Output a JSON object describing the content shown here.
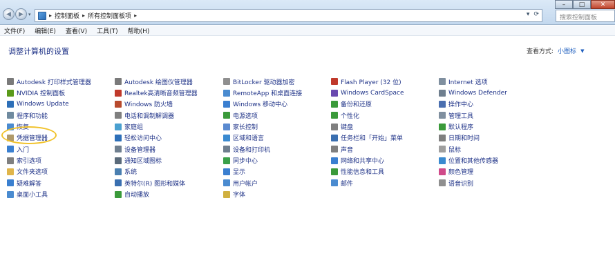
{
  "window": {
    "breadcrumb": [
      "控制面板",
      "所有控制面板项"
    ],
    "search_placeholder": "搜索控制面板",
    "controls": {
      "minimize": "–",
      "maximize": "□",
      "close": "✕"
    }
  },
  "menu": [
    "文件(F)",
    "编辑(E)",
    "查看(V)",
    "工具(T)",
    "帮助(H)"
  ],
  "page": {
    "title": "调整计算机的设置",
    "view_by_label": "查看方式:",
    "view_by_value": "小图标"
  },
  "columns": [
    [
      {
        "label": "Autodesk 打印样式管理器",
        "icon": "printer-style-icon",
        "color": "#7a7a7a"
      },
      {
        "label": "NVIDIA 控制面板",
        "icon": "nvidia-icon",
        "color": "#5a9a1a"
      },
      {
        "label": "Windows Update",
        "icon": "windows-update-icon",
        "color": "#2d6fb8"
      },
      {
        "label": "程序和功能",
        "icon": "programs-icon",
        "color": "#6f8a9f"
      },
      {
        "label": "恢复",
        "icon": "recovery-icon",
        "color": "#4a8bd0"
      },
      {
        "label": "凭据管理器",
        "icon": "credential-manager-icon",
        "color": "#b09a6a"
      },
      {
        "label": "入门",
        "icon": "getting-started-icon",
        "color": "#3a7fd0"
      },
      {
        "label": "索引选项",
        "icon": "indexing-icon",
        "color": "#7f7f7f"
      },
      {
        "label": "文件夹选项",
        "icon": "folder-options-icon",
        "color": "#e0b54a"
      },
      {
        "label": "疑难解答",
        "icon": "troubleshooting-icon",
        "color": "#3a7fd0"
      },
      {
        "label": "桌面小工具",
        "icon": "gadgets-icon",
        "color": "#4a8bd0"
      }
    ],
    [
      {
        "label": "Autodesk 绘图仪管理器",
        "icon": "plotter-icon",
        "color": "#7a7a7a"
      },
      {
        "label": "Realtek高清晰音频管理器",
        "icon": "realtek-audio-icon",
        "color": "#c0392b"
      },
      {
        "label": "Windows 防火墙",
        "icon": "firewall-icon",
        "color": "#b84a2d"
      },
      {
        "label": "电话和调制解调器",
        "icon": "phone-modem-icon",
        "color": "#7f7f7f"
      },
      {
        "label": "家庭组",
        "icon": "homegroup-icon",
        "color": "#4aa0d0"
      },
      {
        "label": "轻松访问中心",
        "icon": "ease-of-access-icon",
        "color": "#2d6fb8"
      },
      {
        "label": "设备管理器",
        "icon": "device-manager-icon",
        "color": "#6f7f8f"
      },
      {
        "label": "通知区域图标",
        "icon": "notification-area-icon",
        "color": "#5a6a7a"
      },
      {
        "label": "系统",
        "icon": "system-icon",
        "color": "#4a7fb0"
      },
      {
        "label": "英特尔(R) 图形和媒体",
        "icon": "intel-graphics-icon",
        "color": "#3a6fb0"
      },
      {
        "label": "自动播放",
        "icon": "autoplay-icon",
        "color": "#3a9a3a"
      }
    ],
    [
      {
        "label": "BitLocker 驱动器加密",
        "icon": "bitlocker-icon",
        "color": "#8f8f8f"
      },
      {
        "label": "RemoteApp 和桌面连接",
        "icon": "remoteapp-icon",
        "color": "#4a8bd0"
      },
      {
        "label": "Windows 移动中心",
        "icon": "mobility-center-icon",
        "color": "#3a7fd0"
      },
      {
        "label": "电源选项",
        "icon": "power-options-icon",
        "color": "#3a9a3a"
      },
      {
        "label": "家长控制",
        "icon": "parental-controls-icon",
        "color": "#5a8ad0"
      },
      {
        "label": "区域和语言",
        "icon": "region-language-icon",
        "color": "#3a8ad0"
      },
      {
        "label": "设备和打印机",
        "icon": "devices-printers-icon",
        "color": "#6f7f8f"
      },
      {
        "label": "同步中心",
        "icon": "sync-center-icon",
        "color": "#3aa04a"
      },
      {
        "label": "显示",
        "icon": "display-icon",
        "color": "#3a7fd0"
      },
      {
        "label": "用户帐户",
        "icon": "user-accounts-icon",
        "color": "#4a8bd0"
      },
      {
        "label": "字体",
        "icon": "fonts-icon",
        "color": "#d0b040"
      }
    ],
    [
      {
        "label": "Flash Player (32 位)",
        "icon": "flash-player-icon",
        "color": "#c0392b"
      },
      {
        "label": "Windows CardSpace",
        "icon": "cardspace-icon",
        "color": "#6a4ab0"
      },
      {
        "label": "备份和还原",
        "icon": "backup-restore-icon",
        "color": "#3a9a3a"
      },
      {
        "label": "个性化",
        "icon": "personalization-icon",
        "color": "#3a9a3a"
      },
      {
        "label": "键盘",
        "icon": "keyboard-icon",
        "color": "#7f7f7f"
      },
      {
        "label": "任务栏和「开始」菜单",
        "icon": "taskbar-start-icon",
        "color": "#3a6fb0"
      },
      {
        "label": "声音",
        "icon": "sound-icon",
        "color": "#7f7f7f"
      },
      {
        "label": "网络和共享中心",
        "icon": "network-sharing-icon",
        "color": "#3a7fd0"
      },
      {
        "label": "性能信息和工具",
        "icon": "performance-icon",
        "color": "#3a9a3a"
      },
      {
        "label": "邮件",
        "icon": "mail-icon",
        "color": "#4a8bd0"
      }
    ],
    [
      {
        "label": "Internet 选项",
        "icon": "internet-options-icon",
        "color": "#7f8f9f"
      },
      {
        "label": "Windows Defender",
        "icon": "windows-defender-icon",
        "color": "#6f7f8f"
      },
      {
        "label": "操作中心",
        "icon": "action-center-icon",
        "color": "#4a6fb0"
      },
      {
        "label": "管理工具",
        "icon": "admin-tools-icon",
        "color": "#7f8f9f"
      },
      {
        "label": "默认程序",
        "icon": "default-programs-icon",
        "color": "#3a9a3a"
      },
      {
        "label": "日期和时间",
        "icon": "date-time-icon",
        "color": "#7f7f7f"
      },
      {
        "label": "鼠标",
        "icon": "mouse-icon",
        "color": "#9f9f9f"
      },
      {
        "label": "位置和其他传感器",
        "icon": "location-sensors-icon",
        "color": "#3a8ad0"
      },
      {
        "label": "颜色管理",
        "icon": "color-management-icon",
        "color": "#d04a8a"
      },
      {
        "label": "语音识别",
        "icon": "speech-recognition-icon",
        "color": "#8f8f8f"
      }
    ]
  ]
}
